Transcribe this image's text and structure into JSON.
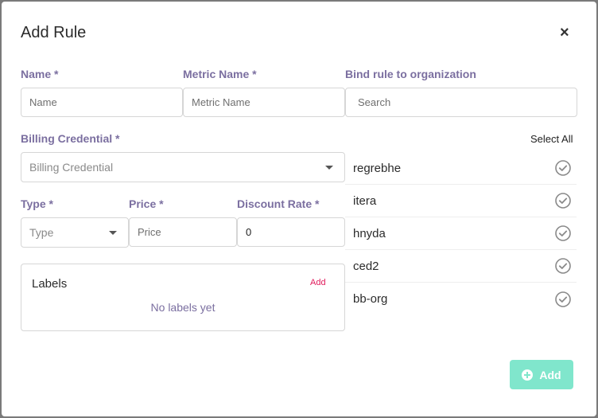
{
  "modal": {
    "title": "Add Rule",
    "close_label": "×"
  },
  "fields": {
    "name": {
      "label": "Name *",
      "placeholder": "Name",
      "value": ""
    },
    "metric_name": {
      "label": "Metric Name *",
      "placeholder": "Metric Name",
      "value": ""
    },
    "bind_org": {
      "label": "Bind rule to organization",
      "placeholder": "Search",
      "value": ""
    },
    "billing_credential": {
      "label": "Billing Credential *",
      "placeholder": "Billing Credential"
    },
    "type": {
      "label": "Type *",
      "placeholder": "Type"
    },
    "price": {
      "label": "Price *",
      "placeholder": "Price",
      "value": ""
    },
    "discount_rate": {
      "label": "Discount Rate *",
      "value": "0"
    }
  },
  "organizations": {
    "select_all_label": "Select All",
    "items": [
      {
        "name": "regrebhe",
        "selected": true
      },
      {
        "name": "itera",
        "selected": true
      },
      {
        "name": "hnyda",
        "selected": true
      },
      {
        "name": "ced2",
        "selected": true
      },
      {
        "name": "bb-org",
        "selected": true
      }
    ]
  },
  "labels": {
    "title": "Labels",
    "add_label": "Add",
    "empty_text": "No labels yet"
  },
  "footer": {
    "add_button_label": "Add"
  },
  "colors": {
    "label_text": "#7b6fa0",
    "add_button_bg": "#80e6cc",
    "labels_add_link": "#e0195a",
    "check_icon": "#8a8a8a"
  }
}
